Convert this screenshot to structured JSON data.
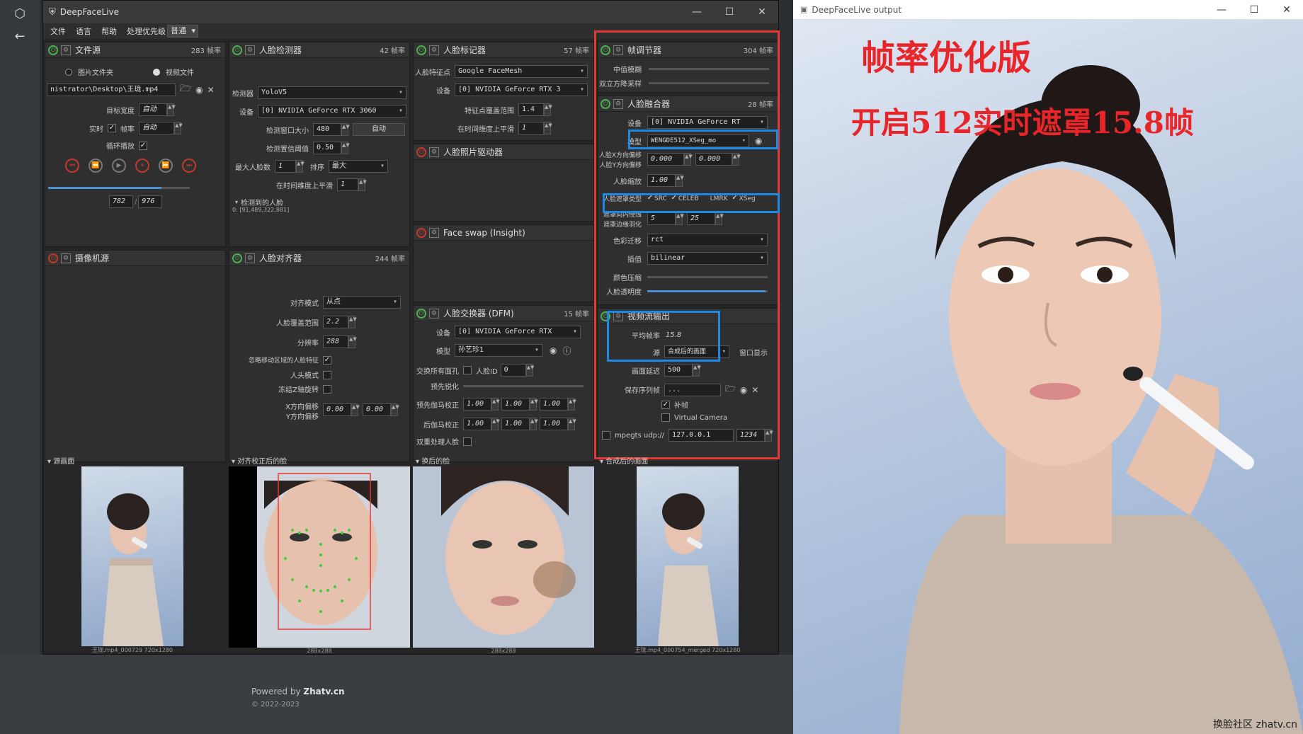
{
  "main_window": {
    "title": "DeepFaceLive",
    "menu": [
      "文件",
      "语言",
      "帮助",
      "处理优先级"
    ],
    "priority": "普通"
  },
  "file_source": {
    "title": "文件源",
    "fps": "283 帧率",
    "opt_folder": "图片文件夹",
    "opt_video": "视频文件",
    "path": "nistrator\\Desktop\\王珑.mp4",
    "target_width_label": "目标宽度",
    "target_width": "自动",
    "realtime_label": "实时",
    "fps_label": "帧率",
    "fps_value": "自动",
    "loop_label": "循环播放",
    "frame": "782",
    "total": "976",
    "progress": 0.8
  },
  "camera_source": {
    "title": "摄像机源"
  },
  "face_detector": {
    "title": "人脸检测器",
    "fps": "42 帧率",
    "detector_label": "检测器",
    "detector": "YoloV5",
    "device_label": "设备",
    "device": "[0] NVIDIA GeForce RTX 3060",
    "window_label": "检测窗口大小",
    "window": "480",
    "auto": "自动",
    "threshold_label": "检测置信阈值",
    "threshold": "0.50",
    "max_faces_label": "最大人脸数",
    "max_faces": "1",
    "sort_label": "排序",
    "sort": "最大",
    "temporal_label": "在时间维度上平滑",
    "temporal": "1",
    "detected_label": "检测到的人脸",
    "detected": "0: [91,489,322,881]"
  },
  "face_aligner": {
    "title": "人脸对齐器",
    "fps": "244 帧率",
    "mode_label": "对齐模式",
    "mode": "从点",
    "coverage_label": "人脸覆盖范围",
    "coverage": "2.2",
    "resolution_label": "分辨率",
    "resolution": "288",
    "exclude_label": "忽略移动区域的人脸特征",
    "head_label": "人头模式",
    "freeze_label": "冻结Z轴旋转",
    "x_label": "X方向偏移",
    "y_label": "Y方向偏移",
    "x": "0.00",
    "y": "0.00"
  },
  "face_marker": {
    "title": "人脸标记器",
    "fps": "57 帧率",
    "marker_label": "人脸特征点",
    "marker": "Google FaceMesh",
    "device_label": "设备",
    "device": "[0] NVIDIA GeForce RTX 3",
    "range_label": "特征点覆盖范围",
    "range": "1.4",
    "temporal_label": "在时间维度上平滑",
    "temporal": "1"
  },
  "face_animator": {
    "title": "人脸照片驱动器"
  },
  "face_swap_insight": {
    "title": "Face swap (Insight)"
  },
  "face_swapper": {
    "title": "人脸交换器 (DFM)",
    "fps": "15 帧率",
    "device_label": "设备",
    "device": "[0] NVIDIA GeForce RTX",
    "model_label": "模型",
    "model": "孙艺珍1",
    "swap_all_label": "交换所有面孔",
    "face_id_label": "人脸ID",
    "face_id": "0",
    "presharpen_label": "预先锐化",
    "pre_gamma_label": "预先伽马校正",
    "pre_gamma": [
      "1.00",
      "1.00",
      "1.00"
    ],
    "post_gamma_label": "后伽马校正",
    "post_gamma": [
      "1.00",
      "1.00",
      "1.00"
    ],
    "two_pass_label": "双重处理人脸"
  },
  "frame_adjuster": {
    "title": "帧调节器",
    "fps": "304 帧率",
    "median_label": "中值模糊",
    "degrade_label": "双立方降采样"
  },
  "face_merger": {
    "title": "人脸融合器",
    "fps": "28 帧率",
    "device_label": "设备",
    "device": "[0] NVIDIA GeForce RT",
    "model_label": "模型",
    "model": "WENGDE512_XSeg_mo",
    "x_offset_label": "人脸X方向偏移",
    "y_offset_label": "人脸Y方向偏移",
    "x_offset": "0.000",
    "y_offset": "0.000",
    "scale_label": "人脸缩放",
    "scale": "1.00",
    "mask_type_label": "人脸遮罩类型",
    "mask_src": "SRC",
    "mask_celeb": "CELEB",
    "mask_lmrk": "LMRK",
    "mask_xseg": "XSeg",
    "erode_label": "遮罩向内侵蚀",
    "blur_label": "遮罩边缘羽化",
    "erode": "5",
    "blur": "25",
    "color_label": "色彩迁移",
    "color": "rct",
    "interp_label": "插值",
    "interp": "bilinear",
    "compress_label": "颜色压缩",
    "opacity_label": "人脸透明度",
    "opacity": 0.98
  },
  "stream_output": {
    "title": "视频流输出",
    "avg_fps_label": "平均帧率",
    "avg_fps": "15.8",
    "source_label": "源",
    "source": "合成后的画面",
    "window_label": "窗口显示",
    "delay_label": "画面延迟",
    "delay": "500",
    "save_label": "保存序列帧",
    "save_path": "...",
    "fill_label": "补帧",
    "vcam_label": "Virtual Camera",
    "mpeg_label": "mpegts udp://",
    "ip": "127.0.0.1",
    "port": "1234"
  },
  "viewers": {
    "source_label": "源画面",
    "aligned_label": "对齐校正后的脸",
    "swapped_label": "换后的脸",
    "merged_label": "合成后的画面",
    "cap_source": "王珑.mp4_000729 720x1280",
    "cap_aligned": "288x288",
    "cap_swapped": "288x288",
    "cap_merged": "王珑.mp4_000754_merged 720x1280"
  },
  "page": {
    "powered_prefix": "Powered by ",
    "powered_brand": "Zhatv.cn",
    "copyright": "© 2022-2023"
  },
  "output_window": {
    "title": "DeepFaceLive output",
    "overlay_line1": "帧率优化版",
    "overlay_line2": "开启512实时遮罩15.8帧",
    "watermark": "换脸社区 zhatv.cn"
  },
  "colors": {
    "highlight_red": "#e53935",
    "highlight_blue": "#1e88e5",
    "overlay_text": "#e8262a",
    "power_on": "#4caf50"
  }
}
